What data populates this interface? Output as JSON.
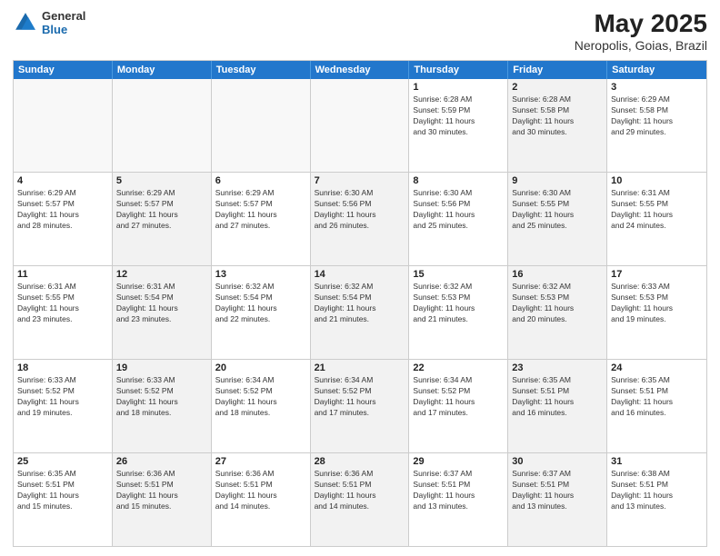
{
  "header": {
    "logo_general": "General",
    "logo_blue": "Blue",
    "title": "May 2025",
    "subtitle": "Neropolis, Goias, Brazil"
  },
  "days_of_week": [
    "Sunday",
    "Monday",
    "Tuesday",
    "Wednesday",
    "Thursday",
    "Friday",
    "Saturday"
  ],
  "weeks": [
    [
      {
        "day": "",
        "info": "",
        "shaded": false,
        "empty": true
      },
      {
        "day": "",
        "info": "",
        "shaded": false,
        "empty": true
      },
      {
        "day": "",
        "info": "",
        "shaded": false,
        "empty": true
      },
      {
        "day": "",
        "info": "",
        "shaded": false,
        "empty": true
      },
      {
        "day": "1",
        "info": "Sunrise: 6:28 AM\nSunset: 5:59 PM\nDaylight: 11 hours\nand 30 minutes.",
        "shaded": false,
        "empty": false
      },
      {
        "day": "2",
        "info": "Sunrise: 6:28 AM\nSunset: 5:58 PM\nDaylight: 11 hours\nand 30 minutes.",
        "shaded": true,
        "empty": false
      },
      {
        "day": "3",
        "info": "Sunrise: 6:29 AM\nSunset: 5:58 PM\nDaylight: 11 hours\nand 29 minutes.",
        "shaded": false,
        "empty": false
      }
    ],
    [
      {
        "day": "4",
        "info": "Sunrise: 6:29 AM\nSunset: 5:57 PM\nDaylight: 11 hours\nand 28 minutes.",
        "shaded": false,
        "empty": false
      },
      {
        "day": "5",
        "info": "Sunrise: 6:29 AM\nSunset: 5:57 PM\nDaylight: 11 hours\nand 27 minutes.",
        "shaded": true,
        "empty": false
      },
      {
        "day": "6",
        "info": "Sunrise: 6:29 AM\nSunset: 5:57 PM\nDaylight: 11 hours\nand 27 minutes.",
        "shaded": false,
        "empty": false
      },
      {
        "day": "7",
        "info": "Sunrise: 6:30 AM\nSunset: 5:56 PM\nDaylight: 11 hours\nand 26 minutes.",
        "shaded": true,
        "empty": false
      },
      {
        "day": "8",
        "info": "Sunrise: 6:30 AM\nSunset: 5:56 PM\nDaylight: 11 hours\nand 25 minutes.",
        "shaded": false,
        "empty": false
      },
      {
        "day": "9",
        "info": "Sunrise: 6:30 AM\nSunset: 5:55 PM\nDaylight: 11 hours\nand 25 minutes.",
        "shaded": true,
        "empty": false
      },
      {
        "day": "10",
        "info": "Sunrise: 6:31 AM\nSunset: 5:55 PM\nDaylight: 11 hours\nand 24 minutes.",
        "shaded": false,
        "empty": false
      }
    ],
    [
      {
        "day": "11",
        "info": "Sunrise: 6:31 AM\nSunset: 5:55 PM\nDaylight: 11 hours\nand 23 minutes.",
        "shaded": false,
        "empty": false
      },
      {
        "day": "12",
        "info": "Sunrise: 6:31 AM\nSunset: 5:54 PM\nDaylight: 11 hours\nand 23 minutes.",
        "shaded": true,
        "empty": false
      },
      {
        "day": "13",
        "info": "Sunrise: 6:32 AM\nSunset: 5:54 PM\nDaylight: 11 hours\nand 22 minutes.",
        "shaded": false,
        "empty": false
      },
      {
        "day": "14",
        "info": "Sunrise: 6:32 AM\nSunset: 5:54 PM\nDaylight: 11 hours\nand 21 minutes.",
        "shaded": true,
        "empty": false
      },
      {
        "day": "15",
        "info": "Sunrise: 6:32 AM\nSunset: 5:53 PM\nDaylight: 11 hours\nand 21 minutes.",
        "shaded": false,
        "empty": false
      },
      {
        "day": "16",
        "info": "Sunrise: 6:32 AM\nSunset: 5:53 PM\nDaylight: 11 hours\nand 20 minutes.",
        "shaded": true,
        "empty": false
      },
      {
        "day": "17",
        "info": "Sunrise: 6:33 AM\nSunset: 5:53 PM\nDaylight: 11 hours\nand 19 minutes.",
        "shaded": false,
        "empty": false
      }
    ],
    [
      {
        "day": "18",
        "info": "Sunrise: 6:33 AM\nSunset: 5:52 PM\nDaylight: 11 hours\nand 19 minutes.",
        "shaded": false,
        "empty": false
      },
      {
        "day": "19",
        "info": "Sunrise: 6:33 AM\nSunset: 5:52 PM\nDaylight: 11 hours\nand 18 minutes.",
        "shaded": true,
        "empty": false
      },
      {
        "day": "20",
        "info": "Sunrise: 6:34 AM\nSunset: 5:52 PM\nDaylight: 11 hours\nand 18 minutes.",
        "shaded": false,
        "empty": false
      },
      {
        "day": "21",
        "info": "Sunrise: 6:34 AM\nSunset: 5:52 PM\nDaylight: 11 hours\nand 17 minutes.",
        "shaded": true,
        "empty": false
      },
      {
        "day": "22",
        "info": "Sunrise: 6:34 AM\nSunset: 5:52 PM\nDaylight: 11 hours\nand 17 minutes.",
        "shaded": false,
        "empty": false
      },
      {
        "day": "23",
        "info": "Sunrise: 6:35 AM\nSunset: 5:51 PM\nDaylight: 11 hours\nand 16 minutes.",
        "shaded": true,
        "empty": false
      },
      {
        "day": "24",
        "info": "Sunrise: 6:35 AM\nSunset: 5:51 PM\nDaylight: 11 hours\nand 16 minutes.",
        "shaded": false,
        "empty": false
      }
    ],
    [
      {
        "day": "25",
        "info": "Sunrise: 6:35 AM\nSunset: 5:51 PM\nDaylight: 11 hours\nand 15 minutes.",
        "shaded": false,
        "empty": false
      },
      {
        "day": "26",
        "info": "Sunrise: 6:36 AM\nSunset: 5:51 PM\nDaylight: 11 hours\nand 15 minutes.",
        "shaded": true,
        "empty": false
      },
      {
        "day": "27",
        "info": "Sunrise: 6:36 AM\nSunset: 5:51 PM\nDaylight: 11 hours\nand 14 minutes.",
        "shaded": false,
        "empty": false
      },
      {
        "day": "28",
        "info": "Sunrise: 6:36 AM\nSunset: 5:51 PM\nDaylight: 11 hours\nand 14 minutes.",
        "shaded": true,
        "empty": false
      },
      {
        "day": "29",
        "info": "Sunrise: 6:37 AM\nSunset: 5:51 PM\nDaylight: 11 hours\nand 13 minutes.",
        "shaded": false,
        "empty": false
      },
      {
        "day": "30",
        "info": "Sunrise: 6:37 AM\nSunset: 5:51 PM\nDaylight: 11 hours\nand 13 minutes.",
        "shaded": true,
        "empty": false
      },
      {
        "day": "31",
        "info": "Sunrise: 6:38 AM\nSunset: 5:51 PM\nDaylight: 11 hours\nand 13 minutes.",
        "shaded": false,
        "empty": false
      }
    ]
  ]
}
